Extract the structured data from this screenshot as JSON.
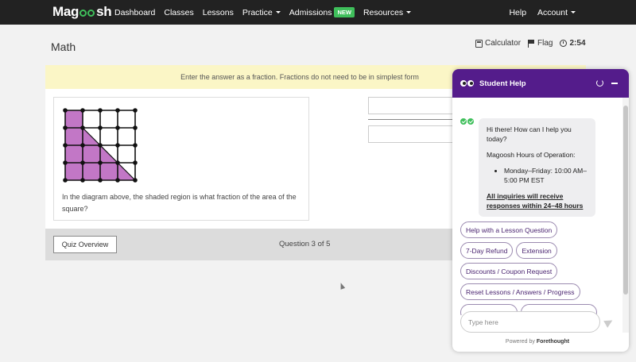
{
  "nav": {
    "logo": "Magoosh",
    "logo_start": "Mag",
    "logo_end": "sh",
    "items": [
      "Dashboard",
      "Classes",
      "Lessons",
      "Practice",
      "Admissions",
      "Resources"
    ],
    "new_badge": "NEW",
    "help": "Help",
    "account": "Account"
  },
  "page": {
    "title": "Math",
    "calculator": "Calculator",
    "flag": "Flag",
    "timer": "2:54",
    "instruction": "Enter the answer as a fraction. Fractions do not need to be in simplest form",
    "question": "In the diagram above, the shaded region is what fraction of the area of the square?",
    "overview_button": "Quiz Overview",
    "question_count": "Question 3 of 5"
  },
  "diagram": {
    "grid_size": 4,
    "shaded_color": "#c277c6",
    "shaded_full_cells": [
      [
        0,
        0
      ],
      [
        0,
        1
      ],
      [
        0,
        2
      ],
      [
        0,
        3
      ],
      [
        1,
        2
      ],
      [
        1,
        3
      ],
      [
        2,
        3
      ]
    ],
    "shaded_half_cells": [
      [
        1,
        1
      ],
      [
        2,
        2
      ],
      [
        3,
        3
      ]
    ]
  },
  "chat": {
    "title": "Student Help",
    "greeting": "Hi there! How can I help you today?",
    "hours_title": "Magoosh Hours of Operation:",
    "hours": "Monday–Friday: 10:00 AM–5:00 PM EST",
    "inquiry": "All inquiries will receive responses within 24–48 hours",
    "options": [
      "Help with a Lesson Question",
      "7-Day Refund",
      "Extension",
      "Discounts / Coupon Request",
      "Reset Lessons / Answers / Progress"
    ],
    "input_placeholder": "Type here",
    "powered_by": "Powered by",
    "powered_brand": "Forethought"
  },
  "colors": {
    "nav_bg": "#222222",
    "accent_green": "#3fbf5b",
    "chat_header": "#541c8b",
    "banner": "#fbf6c6"
  }
}
